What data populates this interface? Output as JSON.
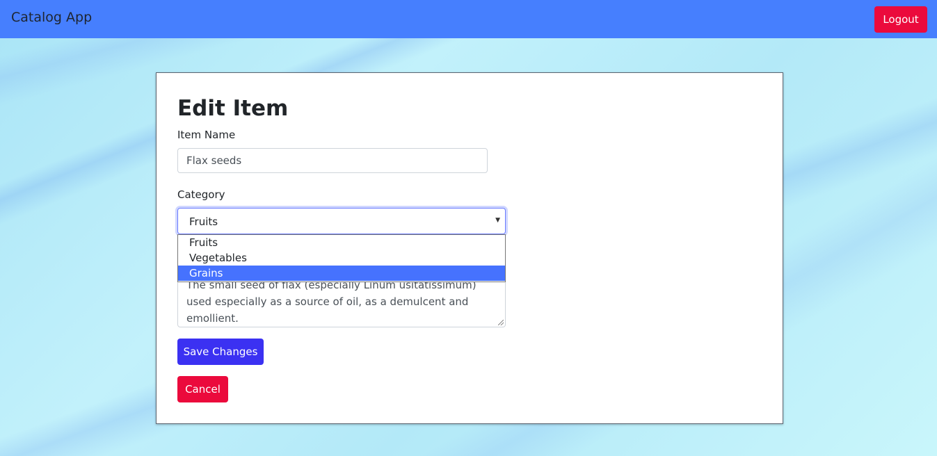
{
  "navbar": {
    "brand": "Catalog App",
    "logout_label": "Logout"
  },
  "form": {
    "title": "Edit Item",
    "item_name_label": "Item Name",
    "item_name_value": "Flax seeds",
    "category_label": "Category",
    "category_selected": "Fruits",
    "category_options": [
      "Fruits",
      "Vegetables",
      "Grains"
    ],
    "category_highlighted": "Grains",
    "description_value": "The small seed of flax (especially Linum usitatissimum) used especially as a source of oil, as a demulcent and emollient.",
    "save_label": "Save Changes",
    "cancel_label": "Cancel"
  },
  "colors": {
    "navbar": "#467ffe",
    "danger": "#eb0a3c",
    "primary": "#3b31f2",
    "option_highlight": "#4672fe"
  }
}
